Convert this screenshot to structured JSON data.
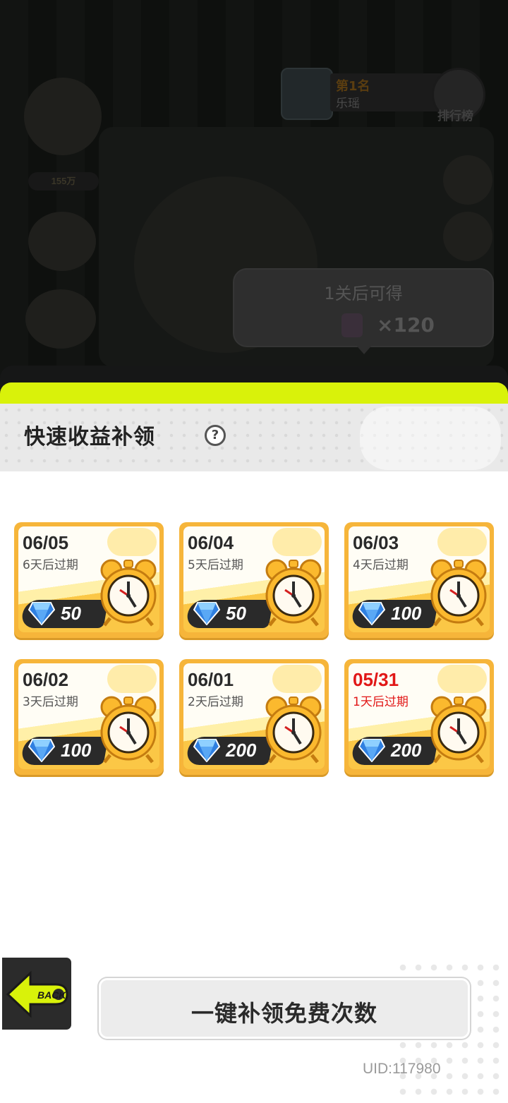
{
  "background": {
    "rank": {
      "place": "第1名",
      "name": "乐瑶",
      "leaderboard_label": "排行榜"
    },
    "currency_badge": "155万",
    "tooltip": {
      "title": "1关后可得",
      "amount": "×120"
    }
  },
  "panel": {
    "title": "快速收益补领",
    "help_symbol": "?"
  },
  "cards": [
    {
      "date": "06/05",
      "expire": "6天后过期",
      "gems": "50",
      "urgent": false
    },
    {
      "date": "06/04",
      "expire": "5天后过期",
      "gems": "50",
      "urgent": false
    },
    {
      "date": "06/03",
      "expire": "4天后过期",
      "gems": "100",
      "urgent": false
    },
    {
      "date": "06/02",
      "expire": "3天后过期",
      "gems": "100",
      "urgent": false
    },
    {
      "date": "06/01",
      "expire": "2天后过期",
      "gems": "200",
      "urgent": false
    },
    {
      "date": "05/31",
      "expire": "1天后过期",
      "gems": "200",
      "urgent": true
    }
  ],
  "footer": {
    "back_label": "BACK",
    "claim_all_label": "一键补领免费次数",
    "uid": "UID:117980"
  },
  "colors": {
    "slime": "#d9f20a",
    "card": "#f6b53a",
    "urgent": "#e11717",
    "gem": "#2f7fe0"
  }
}
